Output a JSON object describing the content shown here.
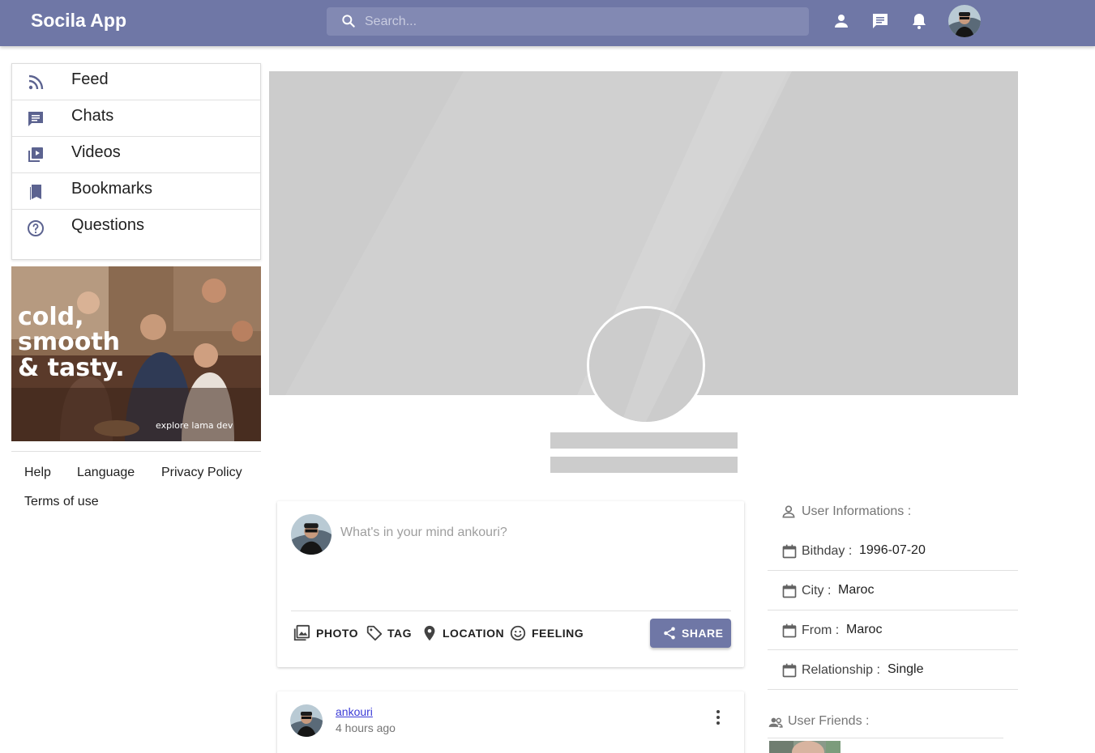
{
  "header": {
    "brand": "Socila App",
    "search_placeholder": "Search...",
    "icons": [
      "person-icon",
      "chat-icon",
      "bell-icon"
    ]
  },
  "sidebar": {
    "items": [
      {
        "label": "Feed",
        "icon": "rss-feed-icon"
      },
      {
        "label": "Chats",
        "icon": "chat-icon"
      },
      {
        "label": "Videos",
        "icon": "video-library-icon"
      },
      {
        "label": "Bookmarks",
        "icon": "bookmarks-icon"
      },
      {
        "label": "Questions",
        "icon": "help-circle-icon"
      }
    ],
    "ad": {
      "line1": "cold,",
      "line2": "smooth",
      "line3": "& tasty.",
      "caption": "explore lama dev"
    },
    "footer_links": [
      "Help",
      "Language",
      "Privacy Policy",
      "Terms of use"
    ]
  },
  "composer": {
    "placeholder": "What's in your mind ankouri?",
    "options": [
      {
        "label": "PHOTO",
        "icon": "photo-library-icon"
      },
      {
        "label": "TAG",
        "icon": "tag-icon"
      },
      {
        "label": "LOCATION",
        "icon": "location-pin-icon"
      },
      {
        "label": "FEELING",
        "icon": "emoji-smile-icon"
      }
    ],
    "share_label": "SHARE"
  },
  "post": {
    "username": "ankouri",
    "time": "4 hours ago"
  },
  "user_info": {
    "title": "User Informations :",
    "rows": [
      {
        "label": "Bithday :",
        "value": "1996-07-20"
      },
      {
        "label": "City :",
        "value": "Maroc"
      },
      {
        "label": "From :",
        "value": "Maroc"
      },
      {
        "label": "Relationship :",
        "value": "Single"
      }
    ],
    "friends_title": "User Friends :"
  },
  "colors": {
    "accent": "#6f77a6",
    "skeleton": "#cccccc",
    "link": "#3b3bd6"
  }
}
